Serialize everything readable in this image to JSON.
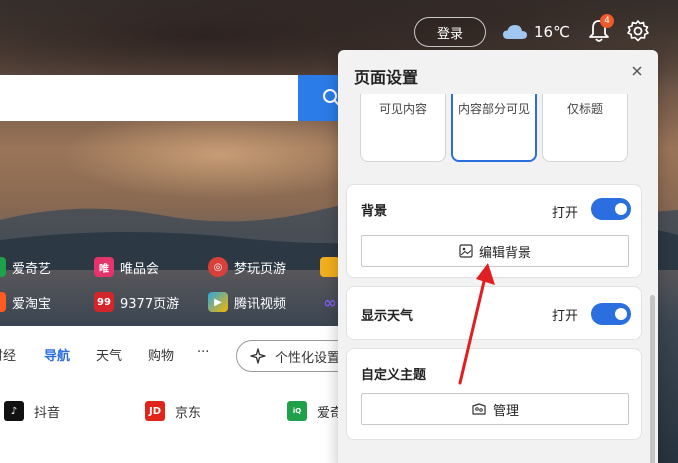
{
  "topbar": {
    "login_label": "登录",
    "temperature": "16℃",
    "notification_count": "4"
  },
  "quick_links": [
    {
      "label": "爱奇艺",
      "icon": "iqiyi-icon"
    },
    {
      "label": "唯品会",
      "icon": "vip-icon"
    },
    {
      "label": "梦玩页游",
      "icon": "mengwan-icon"
    },
    {
      "label": "爱淘宝",
      "icon": "taobao-icon"
    },
    {
      "label": "9377页游",
      "icon": "9377-icon"
    },
    {
      "label": "腾讯视频",
      "icon": "tencent-video-icon"
    }
  ],
  "tabs": [
    {
      "label": "财经"
    },
    {
      "label": "导航",
      "active": true
    },
    {
      "label": "天气"
    },
    {
      "label": "购物"
    },
    {
      "label": "···"
    }
  ],
  "personalize_label": "个性化设置",
  "sites": [
    {
      "label": "抖音",
      "icon": "douyin-icon"
    },
    {
      "label": "京东",
      "icon": "jd-icon"
    },
    {
      "label": "爱奇",
      "icon": "iqiyi-icon"
    }
  ],
  "panel": {
    "title": "页面设置",
    "layout_options": [
      {
        "label": "可见内容"
      },
      {
        "label": "内容部分可见",
        "selected": true
      },
      {
        "label": "仅标题"
      }
    ],
    "background": {
      "label": "背景",
      "toggle_label": "打开",
      "toggle_on": true,
      "edit_button": "编辑背景"
    },
    "weather": {
      "label": "显示天气",
      "toggle_label": "打开",
      "toggle_on": true
    },
    "theme": {
      "label": "自定义主题",
      "manage_button": "管理"
    }
  },
  "colors": {
    "accent": "#2b6ee0",
    "search_button": "#2b7ce9",
    "badge": "#f05a28",
    "arrow": "#e02020"
  }
}
